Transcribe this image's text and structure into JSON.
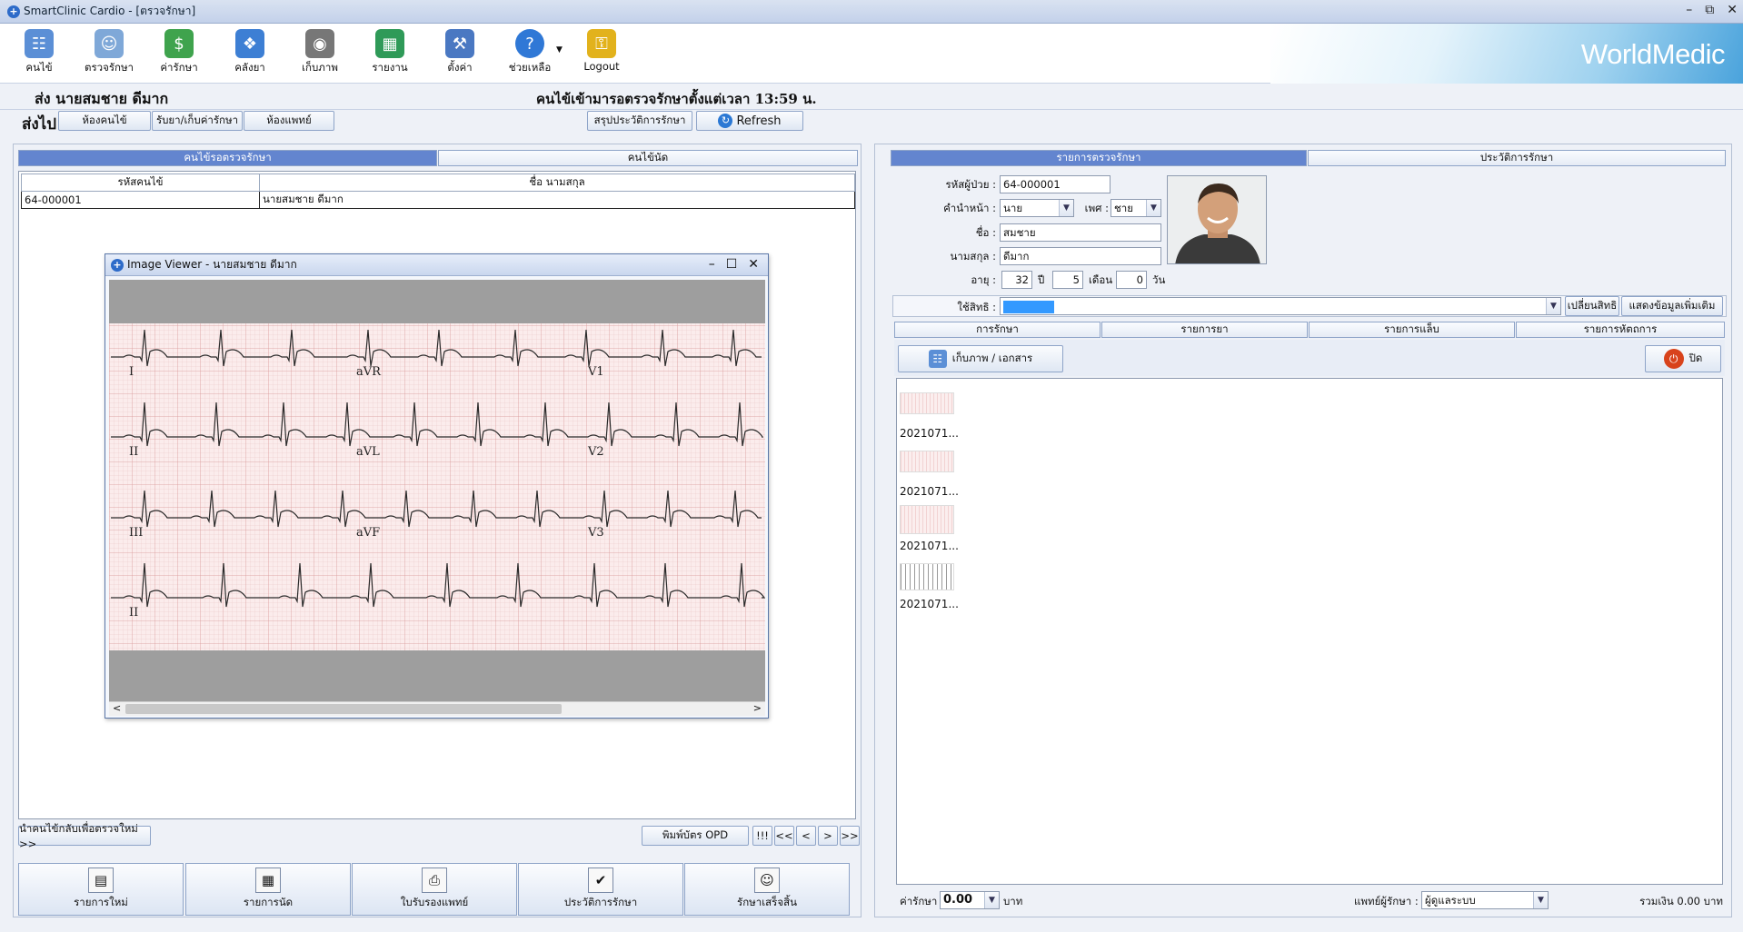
{
  "window": {
    "title": "SmartClinic Cardio - [ตรวจรักษา]"
  },
  "toolbar": {
    "items": [
      {
        "label": "คนไข้"
      },
      {
        "label": "ตรวจรักษา"
      },
      {
        "label": "ค่ารักษา"
      },
      {
        "label": "คลังยา"
      },
      {
        "label": "เก็บภาพ"
      },
      {
        "label": "รายงาน"
      },
      {
        "label": "ตั้งค่า"
      },
      {
        "label": "ช่วยเหลือ"
      },
      {
        "label": "Logout"
      }
    ],
    "brand": "WorldMedic"
  },
  "header": {
    "send_line": "ส่ง  นายสมชาย ดีมาก",
    "arrival_line": "คนไข้เข้ามารอตรวจรักษาตั้งแต่เวลา 13:59 น.",
    "goto_label": "ส่งไป",
    "goto_buttons": [
      "ห้องคนไข้",
      "รับยา/เก็บค่ารักษา",
      "ห้องแพทย์"
    ],
    "summary_button": "สรุปประวัติการรักษา",
    "refresh_button": "Refresh"
  },
  "left": {
    "tabs": [
      "คนไข้รอตรวจรักษา",
      "คนไข้นัด"
    ],
    "columns": [
      "รหัสคนไข้",
      "ชื่อ นามสกุล"
    ],
    "rows": [
      {
        "id": "64-000001",
        "name": "นายสมชาย ดีมาก"
      }
    ],
    "return_button": "นำคนไข้กลับเพื่อตรวจใหม่ >>",
    "print_opd": "พิมพ์บัตร OPD",
    "nav": [
      "!!!",
      "<<",
      "<",
      ">",
      ">>"
    ],
    "bottom_buttons": [
      "รายการใหม่",
      "รายการนัด",
      "ใบรับรองแพทย์",
      "ประวัติการรักษา",
      "รักษาเสร็จสิ้น"
    ]
  },
  "viewer": {
    "title": "Image Viewer - นายสมชาย ดีมาก",
    "leads": [
      "I",
      "aVR",
      "V1",
      "II",
      "aVL",
      "V2",
      "III",
      "aVF",
      "V3",
      "II"
    ]
  },
  "right": {
    "tabs": [
      "รายการตรวจรักษา",
      "ประวัติการรักษา"
    ],
    "patient": {
      "id_label": "รหัสผู้ป่วย :",
      "id": "64-000001",
      "prefix_label": "คำนำหน้า :",
      "prefix": "นาย",
      "sex_label": "เพศ :",
      "sex": "ชาย",
      "first_label": "ชื่อ :",
      "first": "สมชาย",
      "last_label": "นามสกุล :",
      "last": "ดีมาก",
      "age_label": "อายุ :",
      "years": "32",
      "years_unit": "ปี",
      "months": "5",
      "months_unit": "เดือน",
      "days": "0",
      "days_unit": "วัน"
    },
    "rights_label": "ใช้สิทธิ :",
    "change_rights": "เปลี่ยนสิทธิ",
    "more_info": "แสดงข้อมูลเพิ่มเติม",
    "subtabs": [
      "การรักษา",
      "รายการยา",
      "รายการแล็บ",
      "รายการหัตถการ"
    ],
    "capture_button": "เก็บภาพ / เอกสาร",
    "close_button": "ปิด",
    "thumbnails": [
      "2021071...",
      "2021071...",
      "2021071...",
      "2021071..."
    ],
    "fee_label": "ค่ารักษา :",
    "fee": "0.00",
    "fee_unit": "บาท",
    "doctor_label": "แพทย์ผู้รักษา :",
    "doctor": "ผู้ดูแลระบบ",
    "total": "รวมเงิน 0.00 บาท"
  }
}
